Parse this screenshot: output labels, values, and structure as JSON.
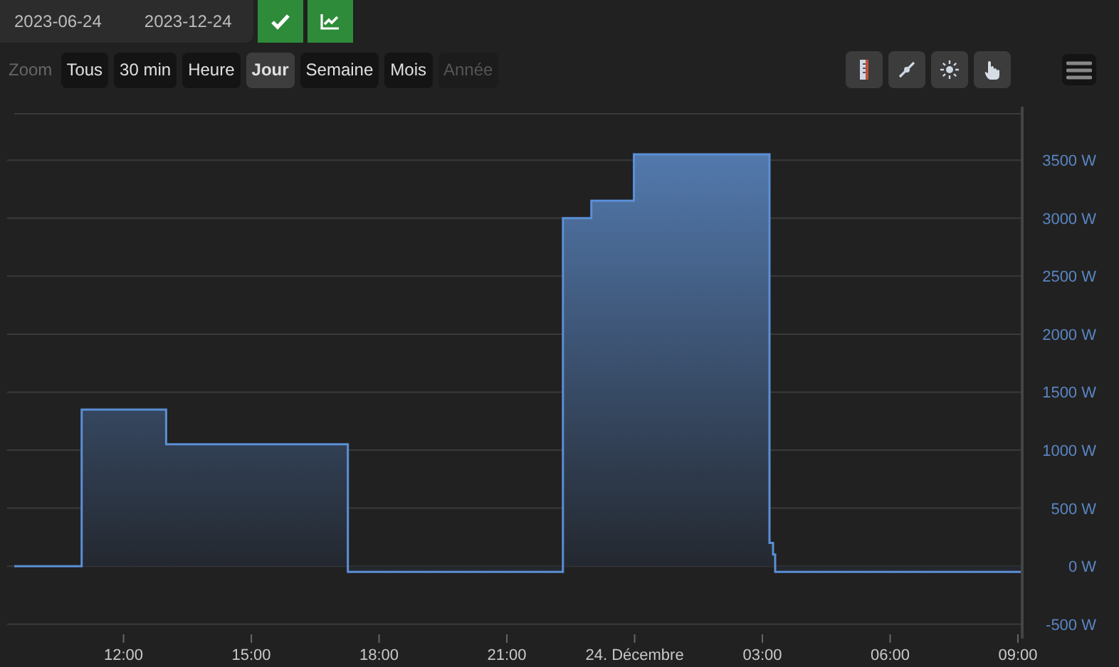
{
  "date_range": {
    "from": "2023-06-24",
    "to": "2023-12-24"
  },
  "zoom": {
    "label": "Zoom",
    "options": [
      {
        "label": "Tous",
        "selected": false,
        "disabled": false
      },
      {
        "label": "30 min",
        "selected": false,
        "disabled": false
      },
      {
        "label": "Heure",
        "selected": false,
        "disabled": false
      },
      {
        "label": "Jour",
        "selected": true,
        "disabled": false
      },
      {
        "label": "Semaine",
        "selected": false,
        "disabled": false
      },
      {
        "label": "Mois",
        "selected": false,
        "disabled": false
      },
      {
        "label": "Année",
        "selected": false,
        "disabled": true
      }
    ]
  },
  "chart_data": {
    "type": "area",
    "grid": true,
    "x": [
      "2023-12-23T09:26",
      "2023-12-23T11:01",
      "2023-12-23T12:00",
      "2023-12-23T13:00",
      "2023-12-23T17:16",
      "2023-12-23T22:19",
      "2023-12-23T22:59",
      "2023-12-23T23:59",
      "2023-12-24T02:00",
      "2023-12-24T03:10",
      "2023-12-24T03:15",
      "2023-12-24T03:18",
      "2023-12-24T09:06"
    ],
    "values": [
      0,
      1350,
      1350,
      1050,
      -50,
      3000,
      3150,
      3550,
      3550,
      200,
      100,
      -50,
      -50
    ],
    "xlim": [
      "2023-12-23T09:26",
      "2023-12-24T09:06"
    ],
    "ylim": [
      -600,
      3900
    ],
    "xticks": [
      {
        "value": "2023-12-23T12:00",
        "label": "12:00"
      },
      {
        "value": "2023-12-23T15:00",
        "label": "15:00"
      },
      {
        "value": "2023-12-23T18:00",
        "label": "18:00"
      },
      {
        "value": "2023-12-23T21:00",
        "label": "21:00"
      },
      {
        "value": "2023-12-24T00:00",
        "label": "24. Décembre"
      },
      {
        "value": "2023-12-24T03:00",
        "label": "03:00"
      },
      {
        "value": "2023-12-24T06:00",
        "label": "06:00"
      },
      {
        "value": "2023-12-24T09:00",
        "label": "09:00"
      }
    ],
    "yticks": [
      {
        "value": -500,
        "label": "-500 W"
      },
      {
        "value": 0,
        "label": "0 W"
      },
      {
        "value": 500,
        "label": "500 W"
      },
      {
        "value": 1000,
        "label": "1000 W"
      },
      {
        "value": 1500,
        "label": "1500 W"
      },
      {
        "value": 2000,
        "label": "2000 W"
      },
      {
        "value": 2500,
        "label": "2500 W"
      },
      {
        "value": 3000,
        "label": "3000 W"
      },
      {
        "value": 3500,
        "label": "3500 W"
      }
    ]
  }
}
